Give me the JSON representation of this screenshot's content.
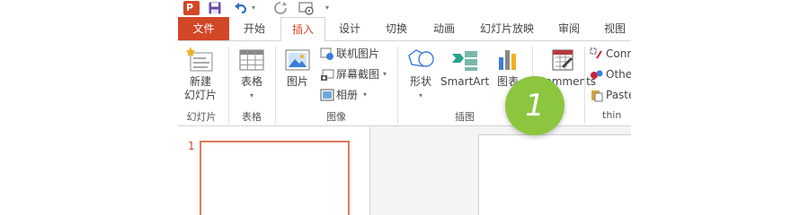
{
  "title_bar": {
    "app_icon_letter": "P"
  },
  "tabs": [
    {
      "label": "文件"
    },
    {
      "label": "开始"
    },
    {
      "label": "插入"
    },
    {
      "label": "设计"
    },
    {
      "label": "切换"
    },
    {
      "label": "动画"
    },
    {
      "label": "幻灯片放映"
    },
    {
      "label": "审阅"
    },
    {
      "label": "视图"
    }
  ],
  "ribbon": {
    "slides_group": {
      "label": "幻灯片",
      "new_slide_line1": "新建",
      "new_slide_line2": "幻灯片"
    },
    "tables_group": {
      "label": "表格",
      "table_button": "表格"
    },
    "images_group": {
      "label": "图像",
      "picture_button": "图片",
      "online_pictures": "联机图片",
      "screenshot": "屏幕截图",
      "photo_album": "相册"
    },
    "illustrations_group": {
      "label": "插图",
      "shapes_button": "形状",
      "smartart_button": "SmartArt",
      "chart_button": "图表"
    },
    "comments_group": {
      "comments_button": "Comments"
    },
    "thinkcell_group": {
      "label": "thin",
      "connect": "Conn",
      "other": "Othe",
      "paste": "Paste"
    }
  },
  "slide_panel": {
    "slide_number": "1"
  },
  "callout": {
    "number": "1"
  },
  "colors": {
    "accent": "#d24726",
    "callout": "#8cc63f"
  }
}
